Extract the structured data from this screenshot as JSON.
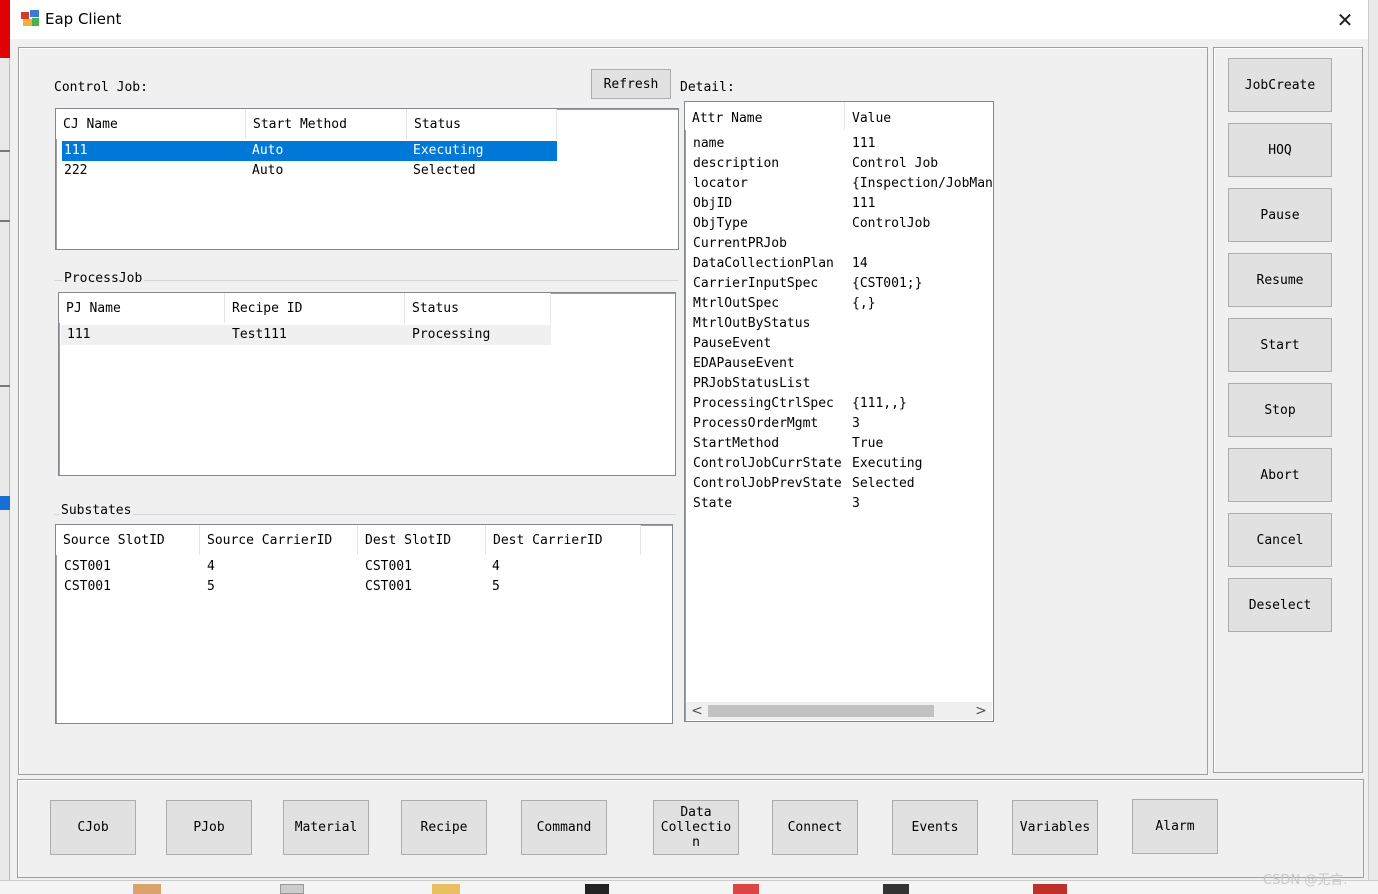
{
  "window": {
    "title": "Eap Client",
    "close_glyph": "✕"
  },
  "control_job": {
    "label": "Control Job:",
    "refresh_label": "Refresh",
    "columns": [
      "CJ Name",
      "Start Method",
      "Status"
    ],
    "rows": [
      {
        "name": "111",
        "start": "Auto",
        "status": "Executing",
        "selected": true
      },
      {
        "name": "222",
        "start": "Auto",
        "status": "Selected",
        "selected": false
      }
    ]
  },
  "process_job": {
    "label": "ProcessJob",
    "columns": [
      "PJ Name",
      "Recipe ID",
      "Status"
    ],
    "rows": [
      {
        "name": "111",
        "recipe": "Test111",
        "status": "Processing"
      }
    ]
  },
  "substates": {
    "label": "Substates",
    "columns": [
      "Source SlotID",
      "Source CarrierID",
      "Dest SlotID",
      "Dest CarrierID"
    ],
    "rows": [
      [
        "CST001",
        "4",
        "CST001",
        "4"
      ],
      [
        "CST001",
        "5",
        "CST001",
        "5"
      ]
    ]
  },
  "detail": {
    "label": "Detail:",
    "columns": [
      "Attr Name",
      "Value"
    ],
    "rows": [
      [
        "name",
        "111"
      ],
      [
        "description",
        "Control Job"
      ],
      [
        "locator",
        "{Inspection/JobManag"
      ],
      [
        "ObjID",
        "111"
      ],
      [
        "ObjType",
        "ControlJob"
      ],
      [
        "CurrentPRJob",
        ""
      ],
      [
        "DataCollectionPlan",
        "14"
      ],
      [
        "CarrierInputSpec",
        "{CST001;}"
      ],
      [
        "MtrlOutSpec",
        "{,}"
      ],
      [
        "MtrlOutByStatus",
        ""
      ],
      [
        "PauseEvent",
        ""
      ],
      [
        "EDAPauseEvent",
        ""
      ],
      [
        "PRJobStatusList",
        ""
      ],
      [
        "ProcessingCtrlSpec",
        "{111,,}"
      ],
      [
        "ProcessOrderMgmt",
        "3"
      ],
      [
        "StartMethod",
        "True"
      ],
      [
        "ControlJobCurrState",
        "Executing"
      ],
      [
        "ControlJobPrevState",
        "Selected"
      ],
      [
        "State",
        "3"
      ]
    ]
  },
  "side_buttons": [
    "JobCreate",
    "HOQ",
    "Pause",
    "Resume",
    "Start",
    "Stop",
    "Abort",
    "Cancel",
    "Deselect"
  ],
  "bottom_buttons": [
    "CJob",
    "PJob",
    "Material",
    "Recipe",
    "Command",
    "Data\nCollectio\nn",
    "Connect",
    "Events",
    "Variables",
    "Alarm"
  ],
  "watermark": "CSDN @无言.",
  "icons": [
    "app-icon",
    "close-icon",
    "scroll-left-icon",
    "scroll-right-icon"
  ]
}
